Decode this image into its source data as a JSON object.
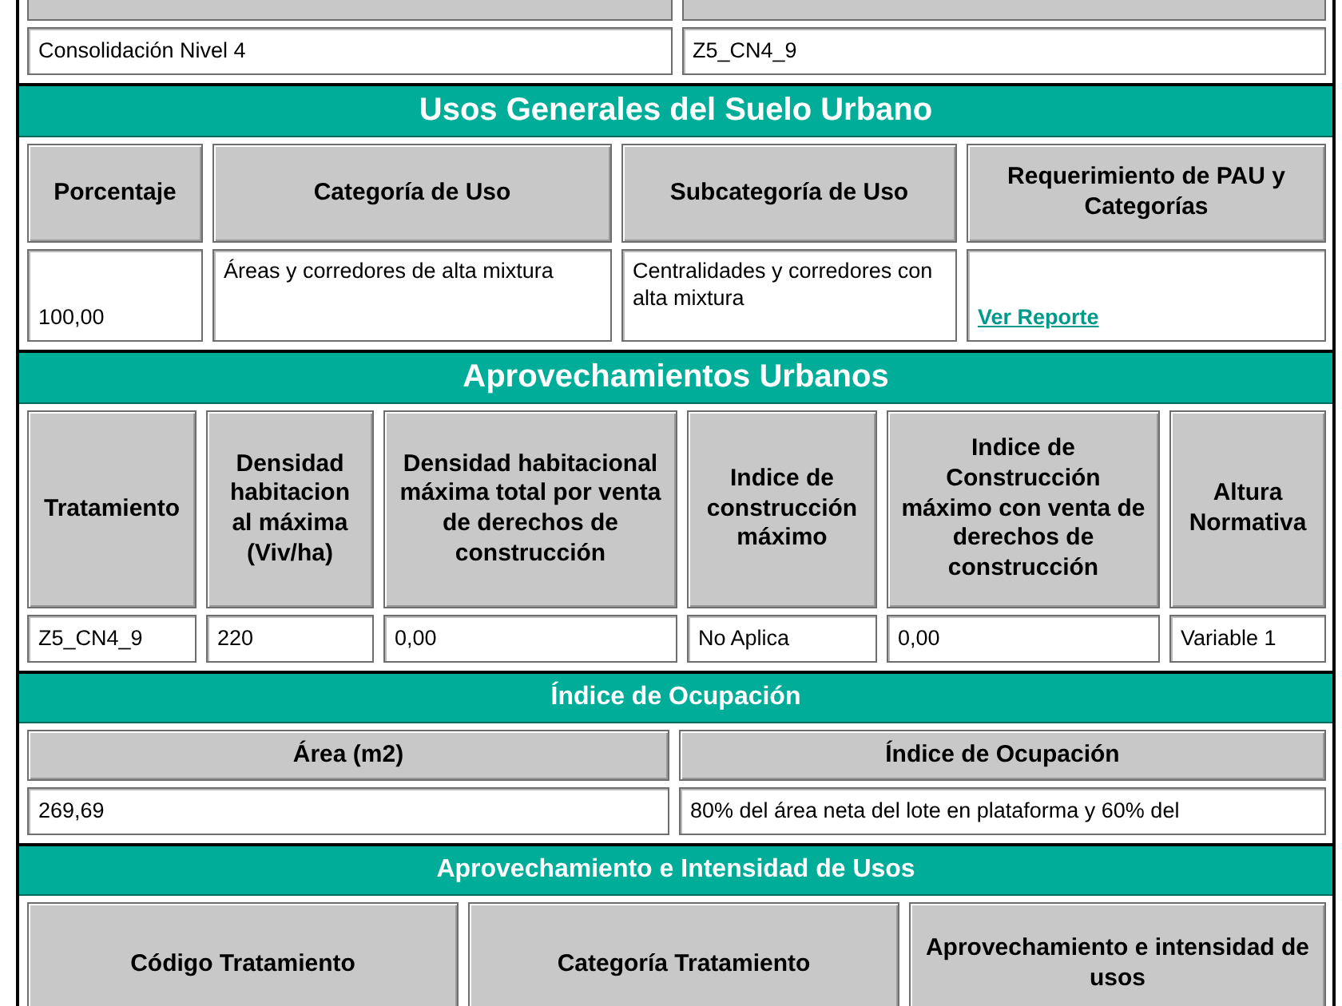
{
  "top_table": {
    "rows": [
      [
        {
          "text": "Consolidación Nivel 4"
        },
        {
          "text": "Z5_CN4_9"
        }
      ]
    ]
  },
  "sections": [
    {
      "title": "Usos Generales del Suelo Urbano",
      "columns": [
        "Porcentaje",
        "Categoría de Uso",
        "Subcategoría de Uso",
        "Requerimiento de PAU y Categorías"
      ],
      "rows": [
        [
          {
            "text": "100,00"
          },
          {
            "text": "Áreas y corredores de alta mixtura"
          },
          {
            "text": "Centralidades y corredores con alta mixtura"
          },
          {
            "text": "Ver Reporte",
            "kind": "link"
          }
        ]
      ]
    },
    {
      "title": "Aprovechamientos Urbanos",
      "columns": [
        "Tratamiento",
        "Densidad habitacion al máxima (Viv/ha)",
        "Densidad habitacional máxima total  por venta  de derechos  de construcción",
        "Indice de construcción máximo",
        "Indice de Construcción máximo con venta de derechos de construcción",
        "Altura Normativa"
      ],
      "rows": [
        [
          {
            "text": "Z5_CN4_9"
          },
          {
            "text": "220"
          },
          {
            "text": "0,00"
          },
          {
            "text": "No Aplica"
          },
          {
            "text": "0,00"
          },
          {
            "text": "Variable 1"
          }
        ]
      ]
    },
    {
      "title": "Índice de Ocupación",
      "columns": [
        "Área (m2)",
        "Índice de Ocupación"
      ],
      "rows": [
        [
          {
            "text": "269,69"
          },
          {
            "text": "80% del área neta del lote en plataforma y 60% del"
          }
        ]
      ]
    },
    {
      "title": "Aprovechamiento e Intensidad de Usos",
      "columns": [
        "Código Tratamiento",
        "Categoría Tratamiento",
        "Aprovechamiento e intensidad de usos"
      ]
    }
  ]
}
